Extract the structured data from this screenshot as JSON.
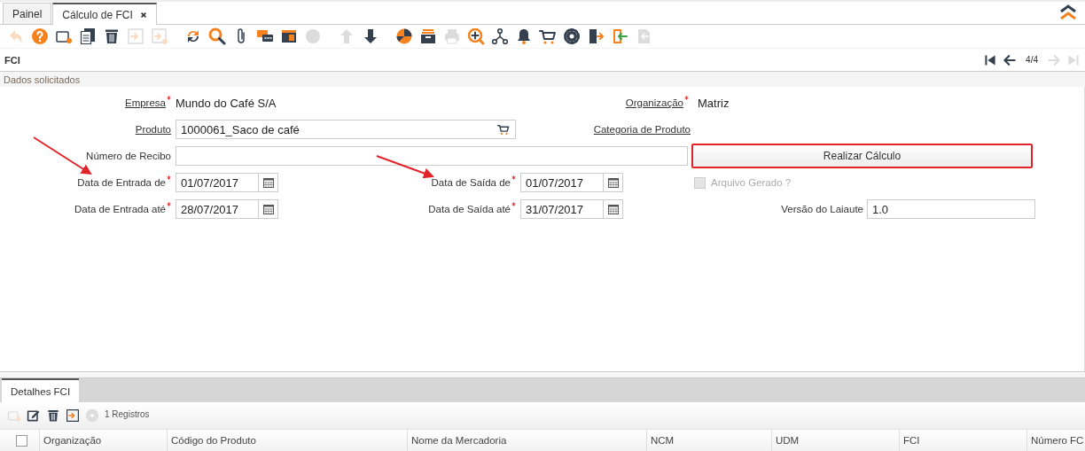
{
  "tabs": [
    {
      "label": "Painel",
      "selected": false,
      "closable": false
    },
    {
      "label": "Cálculo de FCI",
      "selected": true,
      "closable": true
    }
  ],
  "toolbar": [
    [
      {
        "kind": "undo",
        "disabled": true
      },
      {
        "kind": "help",
        "disabled": false
      },
      {
        "kind": "new",
        "disabled": false
      },
      {
        "kind": "copy",
        "disabled": false
      },
      {
        "kind": "delete",
        "disabled": false
      },
      {
        "kind": "export",
        "disabled": true
      },
      {
        "kind": "export2",
        "disabled": true
      }
    ],
    [
      {
        "kind": "refresh",
        "disabled": false
      },
      {
        "kind": "search",
        "disabled": false
      },
      {
        "kind": "attach",
        "disabled": false
      },
      {
        "kind": "chat",
        "disabled": false
      },
      {
        "kind": "report",
        "disabled": false
      },
      {
        "kind": "palette",
        "disabled": true
      }
    ],
    [
      {
        "kind": "up",
        "disabled": true
      },
      {
        "kind": "down",
        "disabled": false
      }
    ],
    [
      {
        "kind": "pie",
        "disabled": false
      },
      {
        "kind": "archive",
        "disabled": false
      },
      {
        "kind": "print",
        "disabled": true
      },
      {
        "kind": "zoom",
        "disabled": false
      },
      {
        "kind": "workflow",
        "disabled": false
      },
      {
        "kind": "bell",
        "disabled": false
      },
      {
        "kind": "cart",
        "disabled": false
      },
      {
        "kind": "gear",
        "disabled": false
      },
      {
        "kind": "exit",
        "disabled": false
      },
      {
        "kind": "import",
        "disabled": false
      },
      {
        "kind": "doc",
        "disabled": true
      }
    ]
  ],
  "header": {
    "title": "FCI",
    "nav_before": [
      {
        "kind": "first",
        "disabled": false
      },
      {
        "kind": "previous",
        "disabled": false
      }
    ],
    "counter": "4/4",
    "nav_after": [
      {
        "kind": "next",
        "disabled": true
      },
      {
        "kind": "last",
        "disabled": true
      }
    ]
  },
  "section": {
    "title": "Dados solicitados"
  },
  "form": [
    {
      "kind": "static",
      "label": "Empresa",
      "required": true,
      "link": true,
      "value": "Mundo do Café S/A"
    },
    {
      "kind": "static",
      "label": "Organização",
      "required": true,
      "link": true,
      "value": "Matriz"
    },
    {
      "kind": "lookup",
      "label": "Produto",
      "link": true,
      "value": "1000061_Saco de café"
    },
    {
      "kind": "label",
      "label": "Categoria de Produto",
      "link": true
    },
    {
      "kind": "text",
      "label": "Número de Recibo",
      "link": false
    },
    {
      "kind": "button",
      "label": "Realizar Cálculo",
      "highlighted": true
    },
    {
      "kind": "date",
      "label": "Data de Entrada de",
      "required": true,
      "link": false,
      "value": "01/07/2017"
    },
    {
      "kind": "date",
      "label": "Data de Saída de",
      "required": true,
      "link": false,
      "value": "01/07/2017"
    },
    {
      "kind": "checkbox",
      "label": "Arquivo Gerado ?",
      "checked": false,
      "disabled": true
    },
    {
      "kind": "date",
      "label": "Data de Entrada até",
      "required": true,
      "link": false,
      "value": "28/07/2017"
    },
    {
      "kind": "date",
      "label": "Data de Saída até",
      "required": true,
      "link": false,
      "value": "31/07/2017"
    },
    {
      "kind": "text",
      "label": "Versão do Laiaute",
      "link": false,
      "value": "1.0"
    }
  ],
  "detail": {
    "tabs": [
      {
        "label": "Detalhes FCI",
        "selected": true
      }
    ],
    "toolbar": [
      {
        "kind": "new",
        "disabled": true
      },
      {
        "kind": "edit",
        "disabled": false
      },
      {
        "kind": "delete",
        "disabled": false
      },
      {
        "kind": "export",
        "disabled": false
      },
      {
        "kind": "gear",
        "disabled": true
      }
    ],
    "count": "1 Registros",
    "select_all": {
      "checked": false
    },
    "columns": [
      "Organização",
      "Código do Produto",
      "Nome da Mercadoria",
      "NCM",
      "UDM",
      "FCI",
      "Número FC"
    ]
  }
}
